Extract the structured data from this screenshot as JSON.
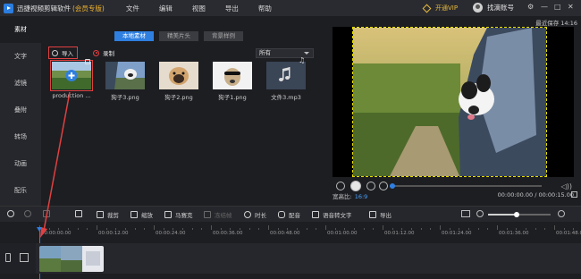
{
  "titlebar": {
    "app_title": "迅捷视频剪辑软件",
    "edition": "(会员专版)",
    "menu": [
      "文件",
      "编辑",
      "视图",
      "导出",
      "帮助"
    ],
    "vip_label": "开通VIP",
    "user_name": "找滴账号",
    "window_controls": [
      "⚙",
      "—",
      "□",
      "✕"
    ]
  },
  "rail": {
    "items": [
      "素材",
      "文字",
      "滤镜",
      "叠附",
      "转场",
      "动画",
      "配乐"
    ],
    "active_index": 0
  },
  "media": {
    "tabs": [
      "本地素材",
      "精美片头",
      "背景样例"
    ],
    "active_tab": 0,
    "import_label": "导入",
    "record_label": "录制",
    "filter_value": "所有",
    "items": [
      {
        "name": "production ...",
        "kind": "video",
        "selected": true
      },
      {
        "name": "狗子3.png",
        "kind": "image"
      },
      {
        "name": "狗子2.png",
        "kind": "image"
      },
      {
        "name": "狗子1.png",
        "kind": "image"
      },
      {
        "name": "文件3.mp3",
        "kind": "audio"
      }
    ]
  },
  "preview": {
    "last_saved": "最近保存 14:16",
    "aspect_label": "宽高比:",
    "aspect_value": "16:9",
    "timecode": "00:00:00.00 / 00:00:15.00",
    "progress": 0.02
  },
  "toolbar": {
    "items": [
      {
        "label": "",
        "icon": "undo-icon",
        "enabled": true
      },
      {
        "label": "",
        "icon": "redo-icon",
        "enabled": false
      },
      {
        "label": "",
        "icon": "edit-icon",
        "enabled": false
      },
      {
        "label": "",
        "icon": "delete-icon",
        "enabled": true
      },
      {
        "label": "裁剪",
        "icon": "crop-icon",
        "enabled": true
      },
      {
        "label": "缩放",
        "icon": "zoom-icon",
        "enabled": true
      },
      {
        "label": "马赛克",
        "icon": "mosaic-icon",
        "enabled": true
      },
      {
        "label": "冻结帧",
        "icon": "freeze-icon",
        "enabled": false
      },
      {
        "label": "时长",
        "icon": "clock-icon",
        "enabled": true
      },
      {
        "label": "配音",
        "icon": "mic-icon",
        "enabled": true
      },
      {
        "label": "语音转文字",
        "icon": "speech-to-text-icon",
        "enabled": true
      },
      {
        "label": "导出",
        "icon": "export-icon",
        "enabled": true
      }
    ],
    "zoom_level": 0.45
  },
  "timeline": {
    "ticks": [
      "00:00:00.00",
      "00:00:12.00",
      "00:00:24.00",
      "00:00:36.00",
      "00:00:48.00",
      "00:01:00.00",
      "00:01:12.00",
      "00:01:24.00",
      "00:01:36.00",
      "00:01:48.00"
    ]
  },
  "colors": {
    "accent": "#2f7fe0",
    "highlight": "#e04040",
    "vip": "#e8b93c",
    "safe_frame": "#e8e000"
  }
}
